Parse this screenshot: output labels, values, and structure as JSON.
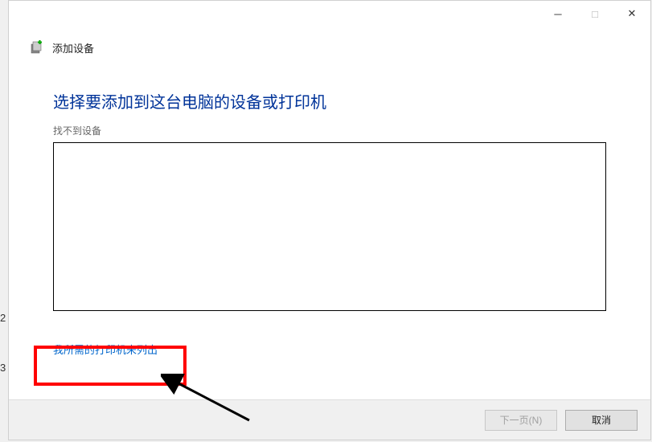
{
  "titlebar": {
    "minimize": "─",
    "maximize": "□",
    "close": "✕"
  },
  "header": {
    "title": "添加设备"
  },
  "content": {
    "heading": "选择要添加到这台电脑的设备或打印机",
    "subtext": "找不到设备",
    "link": "我所需的打印机未列出"
  },
  "footer": {
    "next": "下一页(N)",
    "cancel": "取消"
  },
  "markers": {
    "m2": "2",
    "m3": "3"
  }
}
